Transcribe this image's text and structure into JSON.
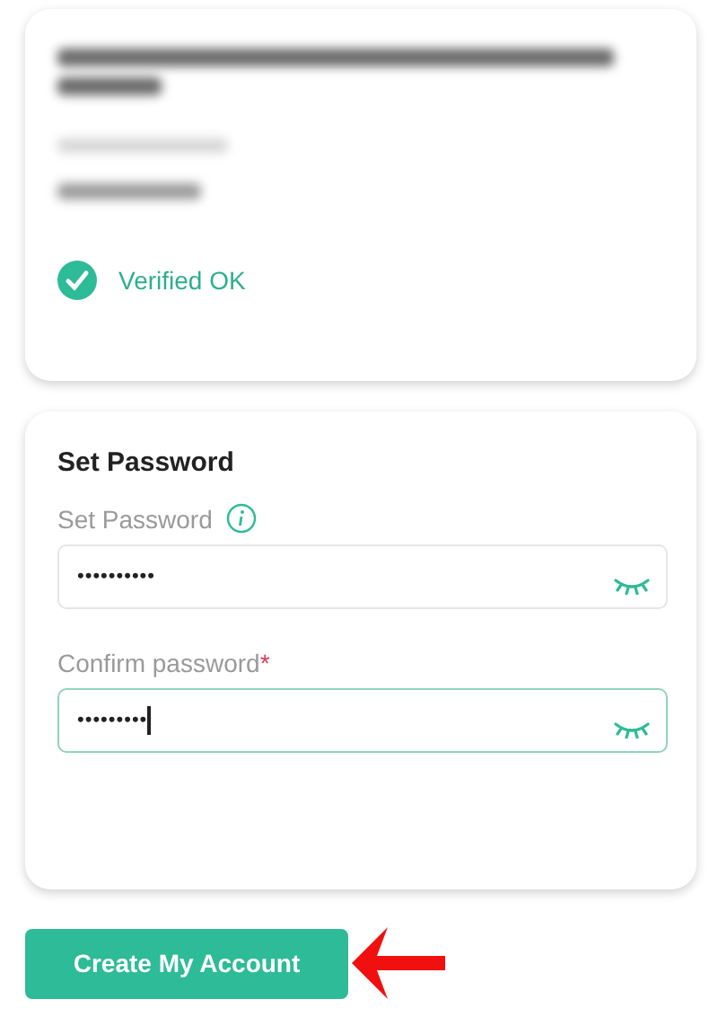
{
  "verification_card": {
    "status": {
      "label": "Verified OK",
      "verified": true
    }
  },
  "password_card": {
    "title": "Set Password",
    "fields": [
      {
        "label": "Set Password",
        "info": true,
        "value": "••••••••••",
        "focused": false
      },
      {
        "label": "Confirm password",
        "required_mark": "*",
        "info": false,
        "value": "•••••••••",
        "focused": true
      }
    ]
  },
  "submit_button": {
    "label": "Create My Account"
  }
}
